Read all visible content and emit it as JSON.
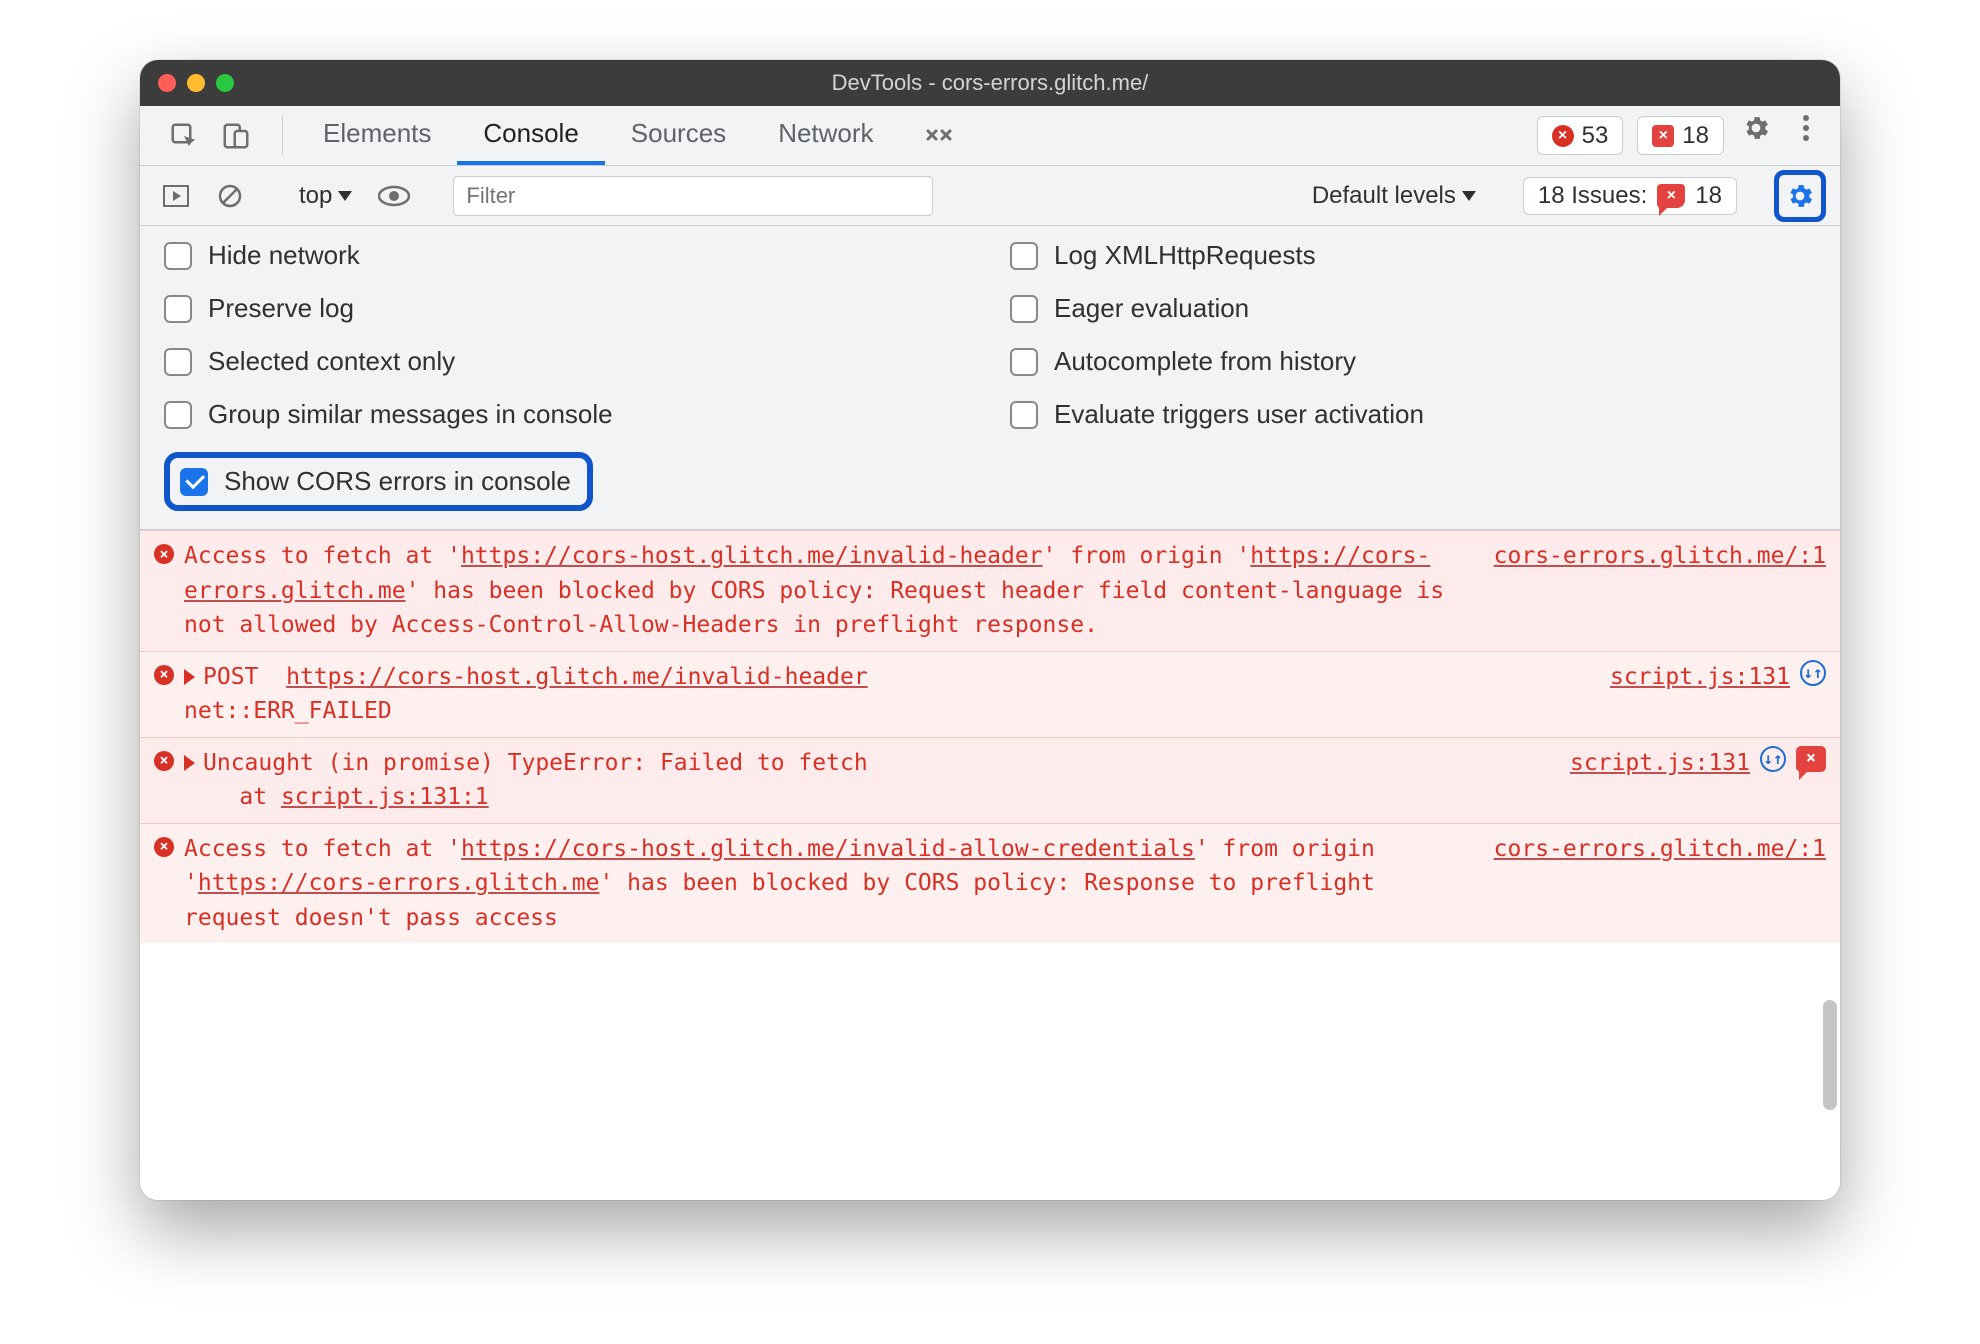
{
  "window": {
    "title": "DevTools - cors-errors.glitch.me/"
  },
  "tabs": {
    "items": [
      "Elements",
      "Console",
      "Sources",
      "Network"
    ],
    "active_index": 1
  },
  "counters": {
    "errors": "53",
    "issues": "18"
  },
  "filterbar": {
    "context": "top",
    "filter_placeholder": "Filter",
    "levels_label": "Default levels",
    "issues_label": "18 Issues:",
    "issues_count": "18"
  },
  "settings": {
    "left": [
      {
        "label": "Hide network",
        "checked": false
      },
      {
        "label": "Preserve log",
        "checked": false
      },
      {
        "label": "Selected context only",
        "checked": false
      },
      {
        "label": "Group similar messages in console",
        "checked": false
      },
      {
        "label": "Show CORS errors in console",
        "checked": true,
        "highlight": true
      }
    ],
    "right": [
      {
        "label": "Log XMLHttpRequests",
        "checked": false
      },
      {
        "label": "Eager evaluation",
        "checked": false
      },
      {
        "label": "Autocomplete from history",
        "checked": false
      },
      {
        "label": "Evaluate triggers user activation",
        "checked": false
      }
    ]
  },
  "console": {
    "messages": [
      {
        "type": "error",
        "body_html": "Access to fetch at '<span class=\"u\">https://cors-host.glitch.me/invalid-header</span>' from origin '<span class=\"u\">https://cors-errors.glitch.me</span>' has been blocked by CORS policy: Request header field content-language is not allowed by Access-Control-Allow-Headers in preflight response.",
        "source": "cors-errors.glitch.me/:1"
      },
      {
        "type": "error",
        "disclosure": true,
        "body_html": "POST&nbsp; <span class=\"u\">https://cors-host.glitch.me/invalid-header</span><br>net::ERR_FAILED",
        "source": "script.js:131",
        "net_icon": true
      },
      {
        "type": "error",
        "disclosure": true,
        "body_html": "Uncaught (in promise) TypeError: Failed to fetch<br>&nbsp;&nbsp;&nbsp;&nbsp;at <span class=\"u\">script.js:131:1</span>",
        "source": "script.js:131",
        "net_icon": true,
        "issue_badge": true
      },
      {
        "type": "error",
        "body_html": "Access to fetch at '<span class=\"u\">https://cors-host.glitch.me/invalid-allow-credentials</span>' from origin '<span class=\"u\">https://cors-errors.glitch.me</span>' has been blocked by CORS policy: Response to preflight request doesn't pass access",
        "source": "cors-errors.glitch.me/:1"
      }
    ]
  }
}
